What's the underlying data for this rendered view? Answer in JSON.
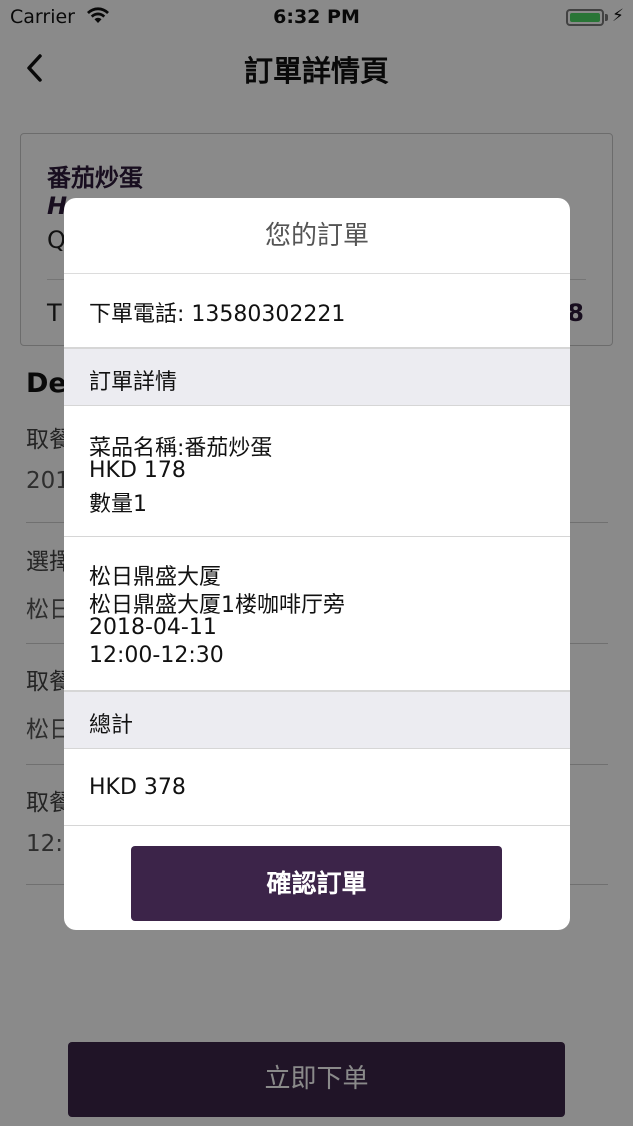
{
  "status_bar": {
    "carrier": "Carrier",
    "time": "6:32 PM",
    "battery_level": 1.0,
    "battery_color": "#4cd964"
  },
  "nav": {
    "title": "訂單詳情頁",
    "back_icon": "chevron-left-icon"
  },
  "background": {
    "card": {
      "dish_name": "番茄炒蛋",
      "price_prefix": "H",
      "qty_prefix": "Q",
      "total_prefix": "T",
      "total_suffix": "8"
    },
    "details_heading": "De",
    "fields": [
      {
        "label": "取餐",
        "value": "201"
      },
      {
        "label": "選擇",
        "value": "松日"
      },
      {
        "label": "取餐",
        "value": "松日"
      },
      {
        "label": "取餐",
        "value": "12:"
      }
    ],
    "order_button": "立即下单"
  },
  "modal": {
    "title": "您的訂單",
    "phone": "下單電話: 13580302221",
    "details_section": "訂單詳情",
    "item": {
      "name": "菜品名稱:番茄炒蛋",
      "price": "HKD 178",
      "quantity": "數量1"
    },
    "pickup": {
      "building": "松日鼎盛大厦",
      "location": "松日鼎盛大厦1楼咖啡厅旁",
      "date": "2018-04-11",
      "time_slot": "12:00-12:30"
    },
    "total_section": "總計",
    "total": "HKD 378",
    "confirm_button": "確認訂單"
  },
  "colors": {
    "brand": "#3c2449",
    "section_bg": "#ececf1",
    "overlay": "rgba(0,0,0,0.46)"
  }
}
